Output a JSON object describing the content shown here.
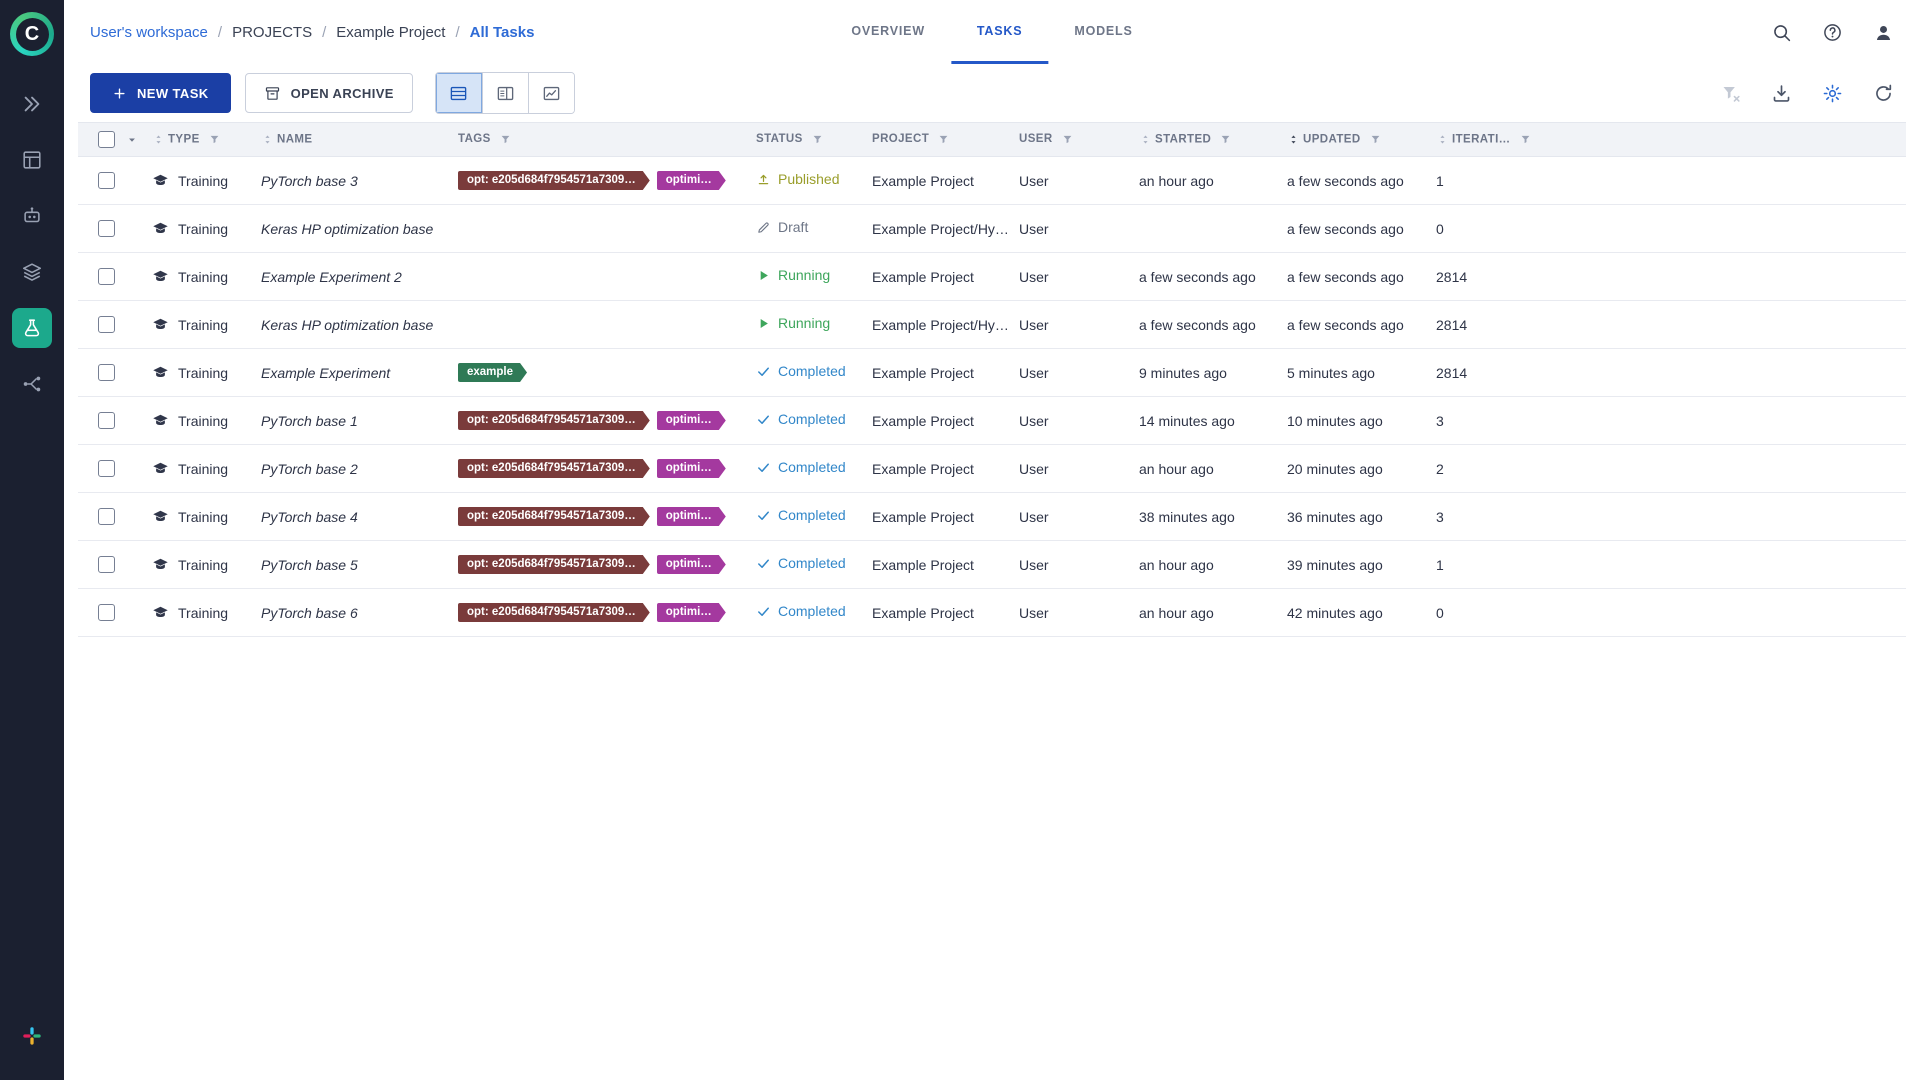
{
  "brand": {
    "logo_letter": "C"
  },
  "colors": {
    "sidebar_active": "#1CA98C",
    "primary_button": "#1B3FA5",
    "accent": "#2458C8",
    "link": "#2E6BD6",
    "settings_icon": "#2A6AD4"
  },
  "sidebar": {
    "items": [
      {
        "name": "expand",
        "icon": "chevrons",
        "active": false
      },
      {
        "name": "projects",
        "icon": "grid",
        "active": false
      },
      {
        "name": "workers",
        "icon": "robot",
        "active": false
      },
      {
        "name": "datasets",
        "icon": "layers",
        "active": false
      },
      {
        "name": "experiments",
        "icon": "flask",
        "active": true
      },
      {
        "name": "pipelines",
        "icon": "pipeline",
        "active": false
      }
    ],
    "bottom": [
      {
        "name": "slack",
        "icon": "slack"
      }
    ]
  },
  "breadcrumb": [
    {
      "label": "User's workspace",
      "style": "link"
    },
    {
      "label": "PROJECTS",
      "style": "plain"
    },
    {
      "label": "Example Project",
      "style": "plain"
    },
    {
      "label": "All Tasks",
      "style": "current"
    }
  ],
  "tabs": [
    {
      "label": "OVERVIEW",
      "active": false
    },
    {
      "label": "TASKS",
      "active": true
    },
    {
      "label": "MODELS",
      "active": false
    }
  ],
  "topbar": {
    "icons": [
      {
        "name": "search",
        "icon": "search"
      },
      {
        "name": "help",
        "icon": "help"
      },
      {
        "name": "profile",
        "icon": "profile"
      }
    ]
  },
  "toolbar": {
    "new_task_label": "NEW TASK",
    "open_archive_label": "OPEN ARCHIVE",
    "right_icons": [
      {
        "name": "clear-filters",
        "icon": "filter-reset",
        "disabled": true
      },
      {
        "name": "download",
        "icon": "download"
      },
      {
        "name": "settings",
        "icon": "gear",
        "accent": true
      },
      {
        "name": "auto-refresh",
        "icon": "refresh"
      }
    ]
  },
  "table": {
    "columns": [
      {
        "key": "type",
        "label": "TYPE",
        "sort": true,
        "filter": true
      },
      {
        "key": "name",
        "label": "NAME",
        "sort": true,
        "filter": false
      },
      {
        "key": "tags",
        "label": "TAGS",
        "sort": false,
        "filter": true
      },
      {
        "key": "status",
        "label": "STATUS",
        "sort": false,
        "filter": true
      },
      {
        "key": "project",
        "label": "PROJECT",
        "sort": false,
        "filter": true
      },
      {
        "key": "user",
        "label": "USER",
        "sort": false,
        "filter": true
      },
      {
        "key": "started",
        "label": "STARTED",
        "sort": true,
        "filter": true
      },
      {
        "key": "updated",
        "label": "UPDATED",
        "sort": true,
        "sorted": true,
        "filter": true
      },
      {
        "key": "iteration",
        "label": "ITERATI…",
        "sort": true,
        "filter": true
      }
    ],
    "status_colors": {
      "published": "#9A9E2B",
      "running": "#3EA65C",
      "completed": "#3287C9",
      "draft": "#6E7687"
    },
    "rows": [
      {
        "type": "Training",
        "name": "PyTorch base 3",
        "tags": [
          {
            "label": "opt: e205d684f7954571a7309…",
            "color": "#7A3B3B"
          },
          {
            "label": "optimi…",
            "color": "#A4399F"
          }
        ],
        "status": "Published",
        "status_key": "published",
        "project": "Example Project",
        "user": "User",
        "started": "an hour ago",
        "updated": "a few seconds ago",
        "iteration": "1"
      },
      {
        "type": "Training",
        "name": "Keras HP optimization base",
        "tags": [],
        "status": "Draft",
        "status_key": "draft",
        "project": "Example Project/Hy…",
        "user": "User",
        "started": "",
        "updated": "a few seconds ago",
        "iteration": "0"
      },
      {
        "type": "Training",
        "name": "Example Experiment 2",
        "tags": [],
        "status": "Running",
        "status_key": "running",
        "project": "Example Project",
        "user": "User",
        "started": "a few seconds ago",
        "updated": "a few seconds ago",
        "iteration": "2814"
      },
      {
        "type": "Training",
        "name": "Keras HP optimization base",
        "tags": [],
        "status": "Running",
        "status_key": "running",
        "project": "Example Project/Hy…",
        "user": "User",
        "started": "a few seconds ago",
        "updated": "a few seconds ago",
        "iteration": "2814"
      },
      {
        "type": "Training",
        "name": "Example Experiment",
        "tags": [
          {
            "label": "example",
            "color": "#2F7A56"
          }
        ],
        "status": "Completed",
        "status_key": "completed",
        "project": "Example Project",
        "user": "User",
        "started": "9 minutes ago",
        "updated": "5 minutes ago",
        "iteration": "2814"
      },
      {
        "type": "Training",
        "name": "PyTorch base 1",
        "tags": [
          {
            "label": "opt: e205d684f7954571a7309…",
            "color": "#7A3B3B"
          },
          {
            "label": "optimi…",
            "color": "#A4399F"
          }
        ],
        "status": "Completed",
        "status_key": "completed",
        "project": "Example Project",
        "user": "User",
        "started": "14 minutes ago",
        "updated": "10 minutes ago",
        "iteration": "3"
      },
      {
        "type": "Training",
        "name": "PyTorch base 2",
        "tags": [
          {
            "label": "opt: e205d684f7954571a7309…",
            "color": "#7A3B3B"
          },
          {
            "label": "optimi…",
            "color": "#A4399F"
          }
        ],
        "status": "Completed",
        "status_key": "completed",
        "project": "Example Project",
        "user": "User",
        "started": "an hour ago",
        "updated": "20 minutes ago",
        "iteration": "2"
      },
      {
        "type": "Training",
        "name": "PyTorch base 4",
        "tags": [
          {
            "label": "opt: e205d684f7954571a7309…",
            "color": "#7A3B3B"
          },
          {
            "label": "optimi…",
            "color": "#A4399F"
          }
        ],
        "status": "Completed",
        "status_key": "completed",
        "project": "Example Project",
        "user": "User",
        "started": "38 minutes ago",
        "updated": "36 minutes ago",
        "iteration": "3"
      },
      {
        "type": "Training",
        "name": "PyTorch base 5",
        "tags": [
          {
            "label": "opt: e205d684f7954571a7309…",
            "color": "#7A3B3B"
          },
          {
            "label": "optimi…",
            "color": "#A4399F"
          }
        ],
        "status": "Completed",
        "status_key": "completed",
        "project": "Example Project",
        "user": "User",
        "started": "an hour ago",
        "updated": "39 minutes ago",
        "iteration": "1"
      },
      {
        "type": "Training",
        "name": "PyTorch base 6",
        "tags": [
          {
            "label": "opt: e205d684f7954571a7309…",
            "color": "#7A3B3B"
          },
          {
            "label": "optimi…",
            "color": "#A4399F"
          }
        ],
        "status": "Completed",
        "status_key": "completed",
        "project": "Example Project",
        "user": "User",
        "started": "an hour ago",
        "updated": "42 minutes ago",
        "iteration": "0"
      }
    ]
  }
}
